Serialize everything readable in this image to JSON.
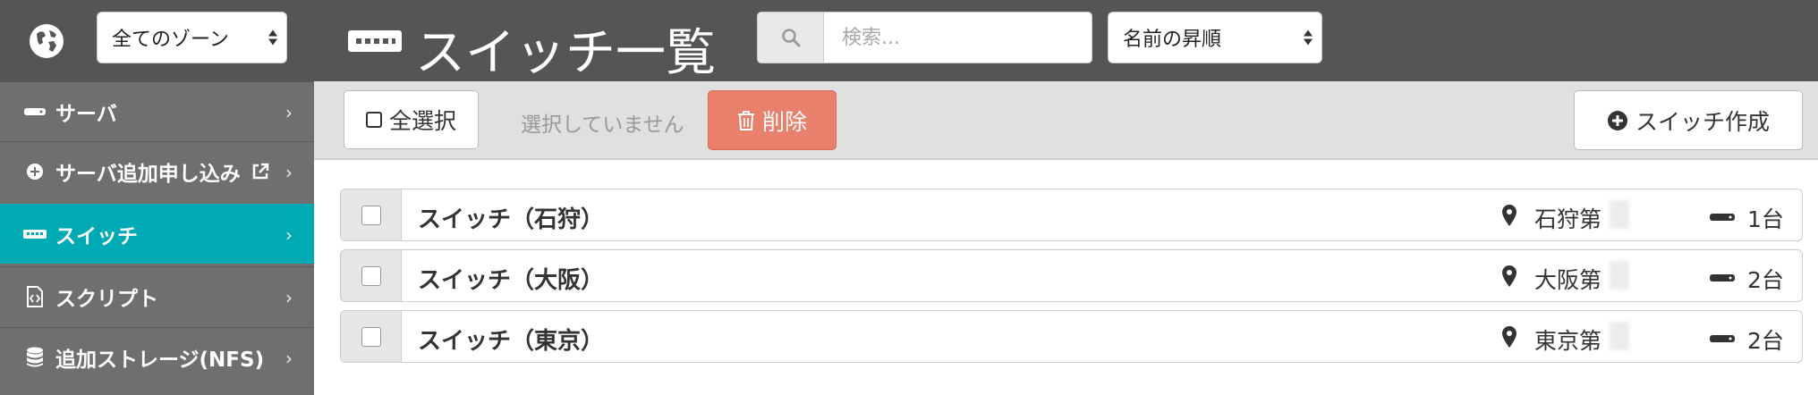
{
  "sidebar": {
    "zone_select": "全てのゾーン",
    "items": [
      {
        "label": "サーバ",
        "icon": "server-icon",
        "active": false
      },
      {
        "label": "サーバ追加申し込み",
        "icon": "plus-circle-icon",
        "external": true,
        "active": false
      },
      {
        "label": "スイッチ",
        "icon": "switch-icon",
        "active": true
      },
      {
        "label": "スクリプト",
        "icon": "script-file-icon",
        "active": false
      },
      {
        "label": "追加ストレージ(NFS)",
        "icon": "database-icon",
        "active": false
      }
    ]
  },
  "header": {
    "title": "スイッチ一覧",
    "search_placeholder": "検索...",
    "sort_select": "名前の昇順"
  },
  "toolbar": {
    "select_all_label": "全選択",
    "selection_status": "選択していません",
    "delete_label": "削除",
    "create_label": "スイッチ作成"
  },
  "switches": [
    {
      "name": "スイッチ（石狩）",
      "zone": "石狩第",
      "count": "1台"
    },
    {
      "name": "スイッチ（大阪）",
      "zone": "大阪第",
      "count": "2台"
    },
    {
      "name": "スイッチ（東京）",
      "zone": "東京第",
      "count": "2台"
    }
  ],
  "colors": {
    "accent": "#00aab4",
    "danger": "#e8806b",
    "header_bg": "#555555",
    "sidebar_bg": "#6f6f6f"
  }
}
